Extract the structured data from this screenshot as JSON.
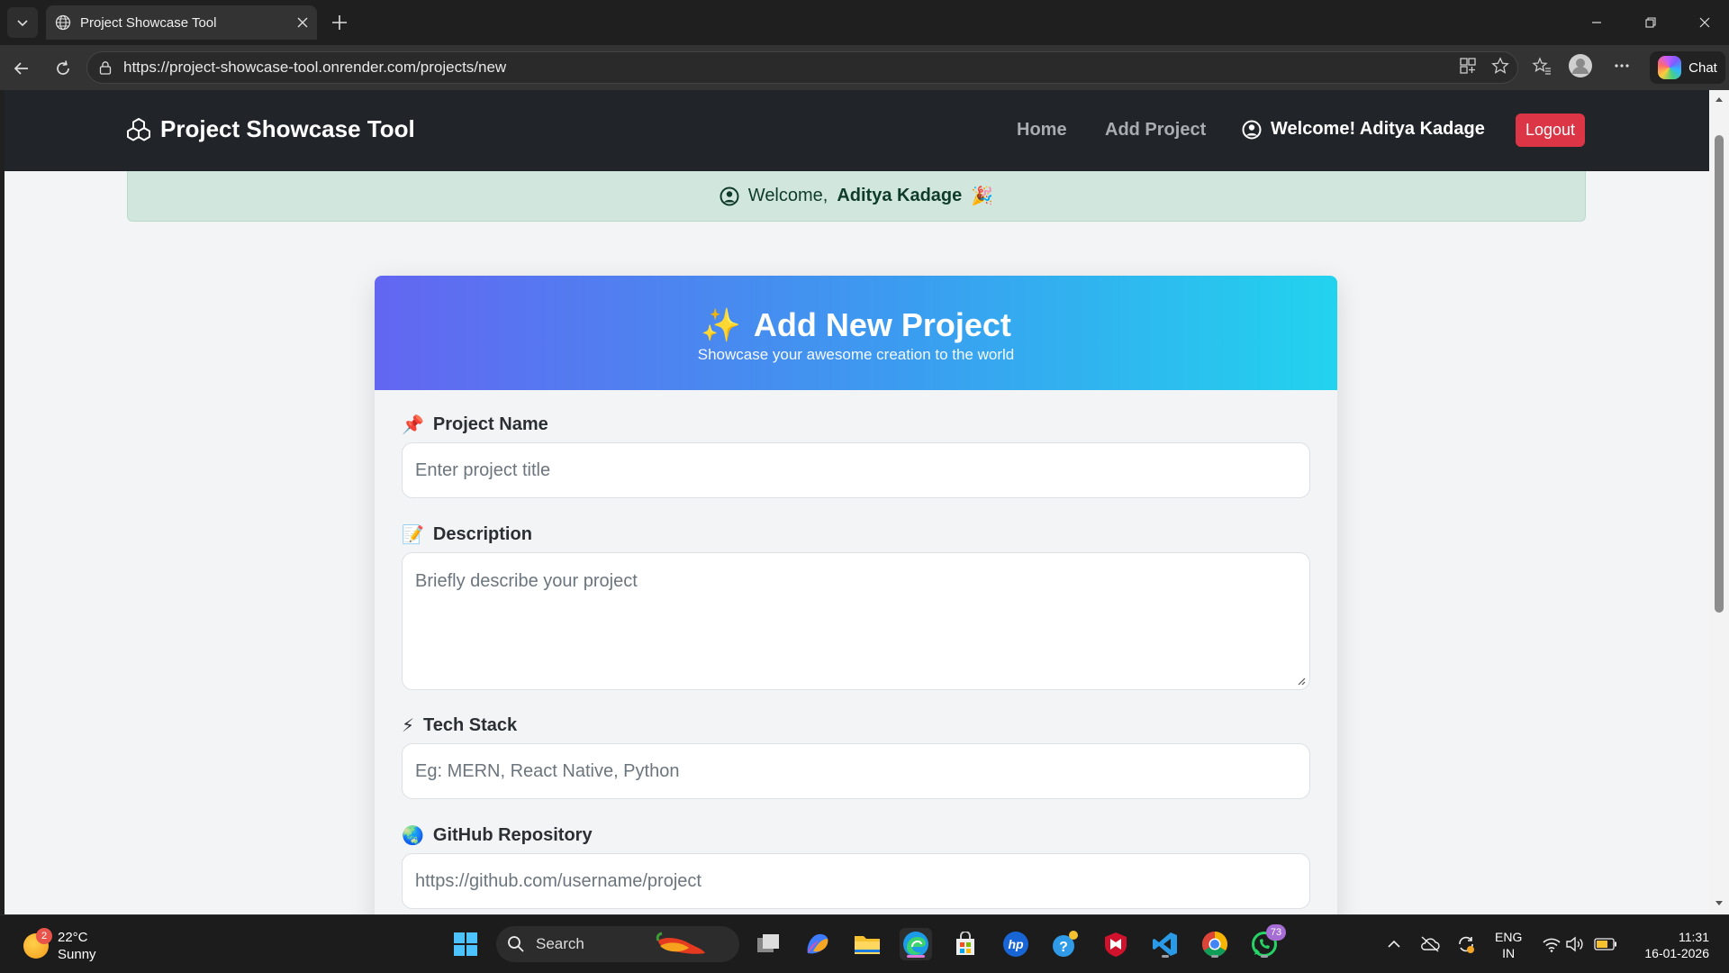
{
  "browser": {
    "tab_title": "Project Showcase Tool",
    "url": "https://project-showcase-tool.onrender.com/projects/new",
    "chat_label": "Chat"
  },
  "navbar": {
    "brand": "Project Showcase Tool",
    "home": "Home",
    "add_project": "Add Project",
    "welcome": "Welcome! Aditya Kadage",
    "logout": "Logout"
  },
  "banner": {
    "prefix": "Welcome,",
    "name": "Aditya Kadage",
    "emoji": "🎉"
  },
  "form": {
    "title_icon": "✨",
    "title": "Add New Project",
    "subtitle": "Showcase your awesome creation to the world",
    "fields": [
      {
        "icon": "📌",
        "label": "Project Name",
        "placeholder": "Enter project title"
      },
      {
        "icon": "📝",
        "label": "Description",
        "placeholder": "Briefly describe your project"
      },
      {
        "icon": "⚡",
        "label": "Tech Stack",
        "placeholder": "Eg: MERN, React Native, Python"
      },
      {
        "icon": "🌏",
        "label": "GitHub Repository",
        "placeholder": "https://github.com/username/project"
      }
    ]
  },
  "taskbar": {
    "weather_badge": "2",
    "temperature": "22°C",
    "condition": "Sunny",
    "search_label": "Search",
    "whatsapp_badge": "73",
    "lang_1": "ENG",
    "lang_2": "IN",
    "time": "11:31",
    "date": "16-01-2026"
  },
  "colors": {
    "navbar_bg": "#212529",
    "logout_bg": "#dc3545",
    "banner_bg": "#d1e7dd",
    "gradient_start": "#6366f1",
    "gradient_end": "#22d3ee"
  }
}
